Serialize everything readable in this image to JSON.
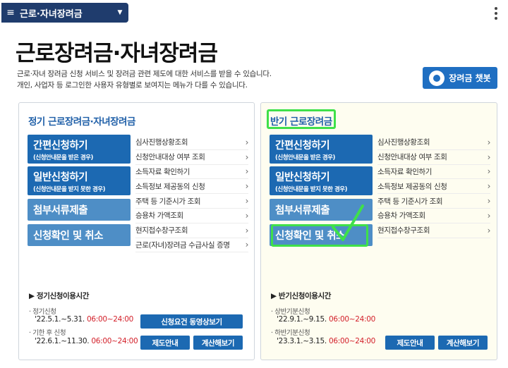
{
  "nav": {
    "title": "근로·자녀장려금"
  },
  "header": {
    "title": "근로장려금·자녀장려금",
    "desc_line1": "근로·자녀 장려금 신청 서비스 및 장려금 관련 제도에 대한 서비스를 받을 수 있습니다.",
    "desc_line2": "개인, 사업자 등 로그인한 사용자 유형별로 보여지는 메뉴가 다를 수 있습니다.",
    "chatbot_label": "장려금 챗봇"
  },
  "left": {
    "title": "정기 근로장려금·자녀장려금",
    "buttons": [
      {
        "main": "간편신청하기",
        "sub": "(신청안내문을 받은 경우)"
      },
      {
        "main": "일반신청하기",
        "sub": "(신청안내문을 받지 못한 경우)"
      },
      {
        "main": "첨부서류제출"
      },
      {
        "main": "신청확인 및 취소"
      }
    ],
    "links": [
      "심사진행상황조회",
      "신청안내대상 여부 조회",
      "소득자료 확인하기",
      "소득정보 제공동의 신청",
      "주택 등 기준시가 조회",
      "승용차 가액조회",
      "현지접수창구조회",
      "근로(자녀)장려금 수급사실 증명"
    ],
    "hours_title": "▶ 정기신청이용시간",
    "period1_label": "· 정기신청",
    "period1_date": "'22.5.1.~5.31.",
    "period1_time": "06:00~24:00",
    "period2_label": "· 기한 후 신청",
    "period2_date": "'22.6.1.~11.30.",
    "period2_time": "06:00~24:00",
    "video_btn": "신청요건 동영상보기",
    "guide_btn": "제도안내",
    "calc_btn": "계산해보기"
  },
  "right": {
    "title": "반기 근로장려금",
    "buttons": [
      {
        "main": "간편신청하기",
        "sub": "(신청안내문을 받은 경우)"
      },
      {
        "main": "일반신청하기",
        "sub": "(신청안내문을 받지 못한 경우)"
      },
      {
        "main": "첨부서류제출"
      },
      {
        "main": "신청확인 및 취소"
      }
    ],
    "links": [
      "심사진행상황조회",
      "신청안내대상 여부 조회",
      "소득자료 확인하기",
      "소득정보 제공동의 신청",
      "주택 등 기준시가 조회",
      "승용차 가액조회",
      "현지접수창구조회"
    ],
    "hours_title": "▶ 반기신청이용시간",
    "period1_label": "· 상반기분신청",
    "period1_date": "'22.9.1.~9.15.",
    "period1_time": "06:00~24:00",
    "period2_label": "· 하반기분신청",
    "period2_date": "'23.3.1.~3.15.",
    "period2_time": "06:00~24:00",
    "guide_btn": "제도안내",
    "calc_btn": "계산해보기"
  },
  "colors": {
    "nav": "#1f3c6d",
    "primary": "#1c69b2",
    "secondary": "#4e8ec6",
    "highlight": "#3fe04a",
    "time": "#d3202a"
  }
}
